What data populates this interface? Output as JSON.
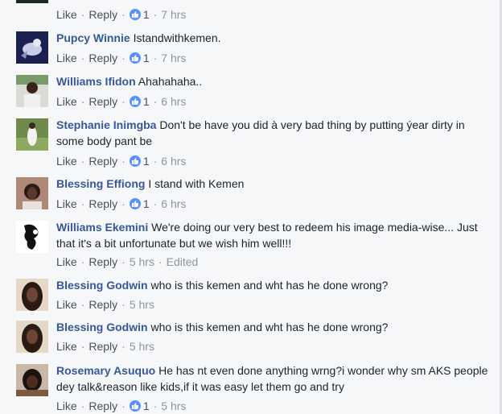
{
  "actions_labels": {
    "like": "Like",
    "reply": "Reply",
    "edited": "Edited"
  },
  "top_partial": {
    "likes": "1",
    "time": "7 hrs"
  },
  "comments": [
    {
      "author": "Pupcy Winnie",
      "text": "Istandwithkemen.",
      "likes": "1",
      "time": "7 hrs"
    },
    {
      "author": "Williams Ifidon",
      "text": "Ahahahaha..",
      "likes": "1",
      "time": "6 hrs"
    },
    {
      "author": "Stephanie Inimgba",
      "text": "Don't be have you did à very bad thing by putting ýear dirty in some body pant be",
      "likes": "1",
      "time": "6 hrs"
    },
    {
      "author": "Blessing Effiong",
      "text": "I stand with Kemen",
      "likes": "1",
      "time": "6 hrs"
    },
    {
      "author": "Williams Ekemini",
      "text": "We're doing our very best to redeem his image media-wise... Just that it's a bit unfortunate but we wish him well!!!",
      "time": "5 hrs",
      "edited": "Edited"
    },
    {
      "author": "Blessing Godwin",
      "text": "who is this kemen and wht has he done wrong?",
      "time": "5 hrs"
    },
    {
      "author": "Blessing Godwin",
      "text": "who is this kemen and wht has he done wrong?",
      "time": "5 hrs"
    },
    {
      "author": "Rosemary Asuquo",
      "text": "He has nt even done anything wrng?i wonder why sm AKS people dey talk&reason like kids,if it was easy let them go and try",
      "likes": "1",
      "time": "5 hrs"
    }
  ],
  "colors": {
    "author": "#365899",
    "meta": "#90949c",
    "like_badge": "#5890ff",
    "background": "#f6f7f9"
  }
}
